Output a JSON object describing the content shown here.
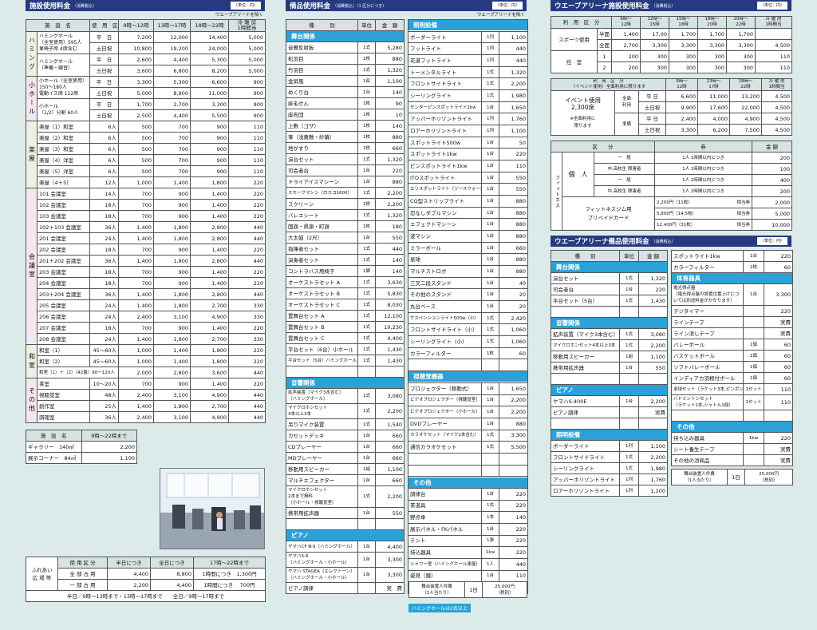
{
  "col1": {
    "title": "施設使用料金",
    "tax": "（消費税込）",
    "unit": "（単位：円）",
    "note": "ウエーブアリーナを除く",
    "h_name": "施　設　名",
    "h_div": "使　用　区　分",
    "h_t": [
      "9時〜12時",
      "13時〜17時",
      "18時〜22時",
      "冷 暖 房\n1時間当"
    ],
    "groups": [
      {
        "name": "ハミング",
        "rows": [
          {
            "n": "ハミングホール\n（全室使用）595人\n車椅子席 4席含む",
            "d": "平　日",
            "v": [
              "7,200",
              "12,000",
              "14,400",
              "5,000"
            ]
          },
          {
            "d": "土日祝",
            "v": [
              "10,800",
              "19,200",
              "24,000",
              "5,000"
            ]
          },
          {
            "n": "ハミングホール\n（準備・練習）",
            "d": "平　日",
            "v": [
              "2,600",
              "4,400",
              "5,300",
              "5,000"
            ]
          },
          {
            "d": "土日祝",
            "v": [
              "3,600",
              "6,800",
              "8,200",
              "5,000"
            ]
          }
        ]
      },
      {
        "name": "小ホール",
        "rows": [
          {
            "n": "小ホール（全室使用）\n150〜180人\n電動イス席 112席",
            "d": "平　日",
            "v": [
              "3,300",
              "5,300",
              "6,600",
              "900"
            ]
          },
          {
            "d": "土日祝",
            "v": [
              "5,000",
              "8,800",
              "11,000",
              "900"
            ]
          },
          {
            "n": "小ホール\n（1/2）分割 60人",
            "d": "平　日",
            "v": [
              "1,700",
              "2,700",
              "3,300",
              "900"
            ]
          },
          {
            "d": "土日祝",
            "v": [
              "2,500",
              "4,400",
              "5,500",
              "900"
            ]
          }
        ]
      },
      {
        "name": "楽屋",
        "rows": [
          {
            "n": "楽屋（1）和室",
            "d": "6人",
            "v": [
              "500",
              "700",
              "900",
              "110"
            ]
          },
          {
            "n": "楽屋（2）和室",
            "d": "6人",
            "v": [
              "500",
              "700",
              "900",
              "110"
            ]
          },
          {
            "n": "楽屋（3）和室",
            "d": "6人",
            "v": [
              "500",
              "700",
              "900",
              "110"
            ]
          },
          {
            "n": "楽屋（4）洋室",
            "d": "6人",
            "v": [
              "500",
              "700",
              "900",
              "110"
            ]
          },
          {
            "n": "楽屋（5）洋室",
            "d": "6人",
            "v": [
              "500",
              "700",
              "900",
              "110"
            ]
          },
          {
            "n": "楽屋（4＋5）",
            "d": "12人",
            "v": [
              "1,000",
              "1,400",
              "1,800",
              "220"
            ]
          }
        ]
      },
      {
        "name": "会議室",
        "rows": [
          {
            "n": "101 会議室",
            "d": "14人",
            "v": [
              "700",
              "900",
              "1,400",
              "220"
            ]
          },
          {
            "n": "102 会議室",
            "d": "18人",
            "v": [
              "700",
              "900",
              "1,400",
              "220"
            ]
          },
          {
            "n": "103 会議室",
            "d": "18人",
            "v": [
              "700",
              "900",
              "1,400",
              "220"
            ]
          },
          {
            "n": "102＋103 会議室",
            "d": "36人",
            "v": [
              "1,400",
              "1,800",
              "2,800",
              "440"
            ]
          },
          {
            "n": "201 会議室",
            "d": "24人",
            "v": [
              "1,400",
              "1,800",
              "2,800",
              "440"
            ]
          },
          {
            "n": "202 会議室",
            "d": "18人",
            "v": [
              "700",
              "900",
              "1,400",
              "220"
            ]
          },
          {
            "n": "201＋202 会議室",
            "d": "36人",
            "v": [
              "1,400",
              "1,800",
              "2,800",
              "440"
            ]
          },
          {
            "n": "203 会議室",
            "d": "18人",
            "v": [
              "700",
              "900",
              "1,400",
              "220"
            ]
          },
          {
            "n": "204 会議室",
            "d": "18人",
            "v": [
              "700",
              "900",
              "1,400",
              "220"
            ]
          },
          {
            "n": "203＋204 会議室",
            "d": "36人",
            "v": [
              "1,400",
              "1,800",
              "2,800",
              "440"
            ]
          },
          {
            "n": "205 会議室",
            "d": "24人",
            "v": [
              "1,400",
              "1,800",
              "2,700",
              "330"
            ]
          },
          {
            "n": "206 会議室",
            "d": "24人",
            "v": [
              "2,400",
              "3,100",
              "4,900",
              "330"
            ]
          },
          {
            "n": "207 会議室",
            "d": "18人",
            "v": [
              "700",
              "900",
              "1,400",
              "220"
            ]
          },
          {
            "n": "208 会議室",
            "d": "24人",
            "v": [
              "1,400",
              "1,800",
              "2,700",
              "330"
            ]
          }
        ]
      },
      {
        "name": "和室",
        "rows": [
          {
            "n": "和室（1）",
            "d": "45〜60人",
            "v": [
              "1,000",
              "1,400",
              "1,800",
              "220"
            ]
          },
          {
            "n": "和室（2）",
            "d": "45〜60人",
            "v": [
              "1,000",
              "1,400",
              "1,800",
              "220"
            ]
          },
          {
            "n": "和室（1）＋（2）（42畳）90〜120人",
            "d": "",
            "v": [
              "2,000",
              "2,800",
              "3,600",
              "440"
            ]
          }
        ]
      },
      {
        "name": "その他",
        "rows": [
          {
            "n": "茶室",
            "d": "10〜20人",
            "v": [
              "700",
              "900",
              "1,400",
              "220"
            ]
          },
          {
            "n": "視聴覚室",
            "d": "48人",
            "v": [
              "2,400",
              "3,100",
              "4,900",
              "440"
            ]
          },
          {
            "n": "創作室",
            "d": "25人",
            "v": [
              "1,400",
              "1,800",
              "2,700",
              "440"
            ]
          },
          {
            "n": "調理室",
            "d": "36人",
            "v": [
              "2,400",
              "3,100",
              "4,900",
              "440"
            ]
          }
        ]
      }
    ],
    "gal_h": [
      "施　設　名",
      "9時〜22時まで"
    ],
    "gal": [
      [
        "ギャラリー　140㎡",
        "2,200"
      ],
      [
        "展示コーナー　84㎡",
        "1,100"
      ]
    ],
    "fure_name": "ふれあい\n広 場 等",
    "fure_h": [
      "使 用 区 分",
      "半日につき",
      "全日につき",
      "17時〜22時まで"
    ],
    "fure": [
      [
        "全 部 占 用",
        "4,400",
        "8,800",
        "1時間につき　1,300円"
      ],
      [
        "一 部 占 用",
        "2,200",
        "4,400",
        "1時間につき　 700円"
      ]
    ],
    "fure_note": "半日／9時〜13時まで・13時〜17時まで　　全日／9時〜17時まで"
  },
  "col2": {
    "title": "備品使用料金",
    "tax": "（消費税込）（1 区分につき）",
    "unit": "（単位：円）",
    "note": "ウエーブアリーナを除く",
    "h": [
      "種　　　別",
      "単位",
      "金　額"
    ],
    "left": [
      {
        "cat": "舞台関係"
      },
      [
        "音響反射板",
        "1式",
        "5,280"
      ],
      [
        "松羽目",
        "1枚",
        "880"
      ],
      [
        "竹羽目",
        "1式",
        "1,320"
      ],
      [
        "金屏風",
        "1双",
        "1,100"
      ],
      [
        "めくり台",
        "1台",
        "140"
      ],
      [
        "緋毛せん",
        "1枚",
        "90"
      ],
      [
        "座布団",
        "1枚",
        "10"
      ],
      [
        "上敷（ゴザ）",
        "1枚",
        "140"
      ],
      [
        "箏（浅黄敷・紗幕）",
        "1枚",
        "880"
      ],
      [
        "地がすり",
        "1枚",
        "660"
      ],
      [
        "演台セット",
        "1式",
        "1,320"
      ],
      [
        "司会者台",
        "1台",
        "220"
      ],
      [
        "ドライアイスマシーン",
        "1台",
        "880"
      ],
      [
        "スモークマシン（ロスコ1600）",
        "1式",
        "2,200"
      ],
      [
        "スクリーン",
        "1枚",
        "2,200"
      ],
      [
        "バレエシート",
        "1式",
        "1,320"
      ],
      [
        "国旗・県旗・町旗",
        "1枚",
        "180"
      ],
      [
        "大太鼓（2尺）",
        "1台",
        "550"
      ],
      [
        "指揮者セット",
        "1式",
        "440"
      ],
      [
        "演奏者セット",
        "1式",
        "140"
      ],
      [
        "コントラバス用椅子",
        "1脚",
        "140"
      ],
      [
        "オーケストラセット A",
        "1式",
        "3,630"
      ],
      [
        "オーケストラセット B",
        "1式",
        "5,830"
      ],
      [
        "オーケストラセット C",
        "1式",
        "8,030"
      ],
      [
        "置舞台セット A",
        "1式",
        "12,100"
      ],
      [
        "置舞台セット B",
        "1式",
        "10,230"
      ],
      [
        "置舞台セット C",
        "1式",
        "4,400"
      ],
      [
        "平台セット（6台）小ホール",
        "1式",
        "1,430"
      ],
      [
        "平台セット（5台）ハミングホール",
        "1式",
        "1,430"
      ],
      [
        "",
        "",
        " "
      ],
      {
        "cat": "音響関係"
      },
      [
        "拡声装置（マイク3本含む）\n（ハミングホール）",
        "1式",
        "3,080"
      ],
      [
        "マイクロホンセット\n4本以上3本",
        "1式",
        "2,200"
      ],
      [
        "吊りマイク装置",
        "1式",
        "1,540"
      ],
      [
        "カセットデッキ",
        "1台",
        "660"
      ],
      [
        "CDプレーヤー",
        "1台",
        "660"
      ],
      [
        "MDプレーヤー",
        "1台",
        "660"
      ],
      [
        "移動用スピーカー",
        "1組",
        "1,100"
      ],
      [
        "マルチエフェクター",
        "1台",
        "660"
      ],
      [
        "マイクロホンセット\n2本まで無料\n（小ホール・視聴覚室）",
        "1式",
        "2,200"
      ],
      [
        "携帯用拡声器",
        "1台",
        "550"
      ],
      [
        "",
        "",
        " "
      ],
      {
        "cat": "ピアノ"
      },
      [
        "ヤマハCF Ⅲ-S（ハミングホール）",
        "1台",
        "4,400"
      ],
      [
        "ヤマハS-6\n（ハミングホール・小ホール）",
        "1台",
        "3,300"
      ],
      [
        "ヤマハ STAGEA（エレクトーン）\n（ハミングホール・小ホール）",
        "1台",
        "3,300"
      ],
      [
        "ピアノ調律",
        "",
        "実　費"
      ]
    ],
    "right": [
      {
        "cat": "照明設備"
      },
      [
        "ボーダーライト",
        "1列",
        "1,100"
      ],
      [
        "フットライト",
        "1列",
        "440"
      ],
      [
        "花道フットライト",
        "1列",
        "440"
      ],
      [
        "トーメンタルライト",
        "1式",
        "1,320"
      ],
      [
        "フロントサイドライト",
        "1式",
        "2,200"
      ],
      [
        "シーリングライト",
        "1式",
        "1,980"
      ],
      [
        "センターピンスポットライト2kw",
        "1台",
        "1,650"
      ],
      [
        "アッパーホリゾントライト",
        "1列",
        "1,760"
      ],
      [
        "ロアーホリゾントライト",
        "1列",
        "1,100"
      ],
      [
        "スポットライト500w",
        "1台",
        "50"
      ],
      [
        "スポットライト1kw",
        "1台",
        "220"
      ],
      [
        "ピンスポットライト1kw",
        "1台",
        "110"
      ],
      [
        "ITOスポットライト",
        "1台",
        "550"
      ],
      [
        "エリスポットライト（ソースフォー含む）",
        "1台",
        "550"
      ],
      [
        "CQ型ストリップライト",
        "1台",
        "880"
      ],
      [
        "忍なしダブルマシン",
        "1台",
        "880"
      ],
      [
        "エフェクトマシーン",
        "1台",
        "880"
      ],
      [
        "波マシン",
        "1台",
        "880"
      ],
      [
        "ミラーボール",
        "1台",
        "660"
      ],
      [
        "星球",
        "1台",
        "880"
      ],
      [
        "マルチストロボ",
        "1台",
        "880"
      ],
      [
        "三叉二段スタンド",
        "1台",
        "40"
      ],
      [
        "その他のスタンド",
        "1台",
        "20"
      ],
      [
        "丸台ベース",
        "1台",
        "20"
      ],
      [
        "サスペンションライト500w（小）",
        "1式",
        "2,420"
      ],
      [
        "フロントサイドライト（小）",
        "1式",
        "1,060"
      ],
      [
        "シーリングライト（小）",
        "1式",
        "1,060"
      ],
      [
        "カラーフィルター",
        "1枚",
        "60"
      ],
      [
        "",
        "",
        " "
      ],
      {
        "cat": "視聴覚機器"
      },
      [
        "プロジェクター（移動式）",
        "1台",
        "1,650"
      ],
      [
        "ビデオプロジェクター（視聴覚室）",
        "1台",
        "2,200"
      ],
      [
        "ビデオプロジェクター（小ホール）",
        "1台",
        "2,200"
      ],
      [
        "DVDプレーヤー",
        "1台",
        "880"
      ],
      [
        "カラオケセット（マイク2本含む）",
        "1式",
        "3,300"
      ],
      [
        "通信カラオケセット",
        "1式",
        "5,500"
      ],
      [
        "",
        "",
        " "
      ],
      [
        "",
        "",
        " "
      ],
      {
        "cat": "その他"
      },
      [
        "調律台",
        "1台",
        "220"
      ],
      [
        "茶道具",
        "1式",
        "220"
      ],
      [
        "野点傘",
        "1本",
        "140"
      ],
      [
        "展示パネル・FKパネル",
        "1台",
        "220"
      ],
      [
        "テント",
        "1張",
        "220"
      ],
      [
        "持込器具",
        "1kw",
        "220"
      ],
      [
        "シャワー室（ハミングホール楽屋）",
        "1人",
        "440"
      ],
      [
        "姿見（鏡）",
        "1台",
        "110"
      ],
      [
        "電動イス（小ホール）",
        "1式",
        "500"
      ]
    ],
    "staff_l": "舞台装置人件費\n（1人当たり）",
    "staff_u": "1日",
    "staff_v": "25,000円\n（税別）",
    "staff_note": "ハミングホールは2名以上"
  },
  "col3": {
    "t1": "ウエーブアリーナ施設使用料金",
    "t1_tax": "（消費税込）",
    "unit": "（単位：円）",
    "h1": [
      "利　用　区　分",
      "9時〜\n12時",
      "12時〜\n15時",
      "15時〜\n18時",
      "18時〜\n20時",
      "20時〜\n22時",
      "冷 暖 房\n1時間当"
    ],
    "sport": "スポーツ使用",
    "ctrl": "控　室",
    "r1": [
      [
        "半面",
        "1,400",
        "17,00",
        "1,700",
        "1,700",
        "1,700",
        ""
      ],
      [
        "全面",
        "2,700",
        "3,300",
        "3,300",
        "3,300",
        "3,300",
        "4,500"
      ],
      [
        "1",
        "200",
        "300",
        "300",
        "300",
        "300",
        "110"
      ],
      [
        "2",
        "200",
        "300",
        "300",
        "300",
        "300",
        "110"
      ]
    ],
    "h2a": "利　用　区　分",
    "h2b": "（イベント使用）全面利用に限ります",
    "h2": [
      "9時〜\n12時",
      "13時〜\n17時",
      "18時〜\n22時",
      "冷 暖 房\n1時間当"
    ],
    "event": "イベント使用\n2,300席",
    "event_note": "※全面利用に\n限ります",
    "full": "全面\n利用",
    "prep": "準備",
    "r2": [
      [
        "平 日",
        "6,600",
        "11,000",
        "13,200",
        "4,500"
      ],
      [
        "土日祝",
        "9,900",
        "17,600",
        "22,000",
        "4,500"
      ],
      [
        "平 日",
        "2,400",
        "4,000",
        "4,900",
        "4,500"
      ],
      [
        "土日祝",
        "3,300",
        "6,200",
        "7,500",
        "4,500"
      ]
    ],
    "h3": [
      "区　　分",
      "券",
      "金 額"
    ],
    "fit": "フィットネス",
    "indiv": "個　人",
    "r3": [
      [
        "一　般",
        "1人 1時間以内につき",
        "200"
      ],
      [
        "中.高校生 障害者",
        "1人 1時間以内につき",
        "100"
      ],
      [
        "一　般",
        "1人 2時間以内につき",
        "400"
      ],
      [
        "中.高校生 障害者",
        "1人 2時間以内につき",
        "200"
      ]
    ],
    "card": "フィットネスジム用\nプリペイドカード",
    "cards": [
      [
        "2,200円（11枚）",
        "相当券",
        "2,000"
      ],
      [
        "5,800円（14.5枚）",
        "相当券",
        "5,000"
      ],
      [
        "12,400円（31枚）",
        "相当券",
        "10,000"
      ]
    ],
    "t2": "ウエーブアリーナ備品使用料金",
    "t2_tax": "（消費税込）",
    "h4": [
      "種　　別",
      "単位",
      "金 額"
    ],
    "bl": [
      {
        "cat": "舞台関係"
      },
      [
        "演台セット",
        "1式",
        "1,320"
      ],
      [
        "司会者台",
        "1台",
        "220"
      ],
      [
        "平台セット（5台）",
        "1式",
        "1,430"
      ],
      [
        "",
        "",
        " "
      ],
      {
        "cat": "音響関係"
      },
      [
        "拡声装置（マイク3本含む）",
        "1式",
        "3,080"
      ],
      [
        "マイクロホンセット4本以上3本",
        "1式",
        "2,200"
      ],
      [
        "移動用スピーカー",
        "1組",
        "1,100"
      ],
      [
        "携帯用拡声器",
        "1台",
        "550"
      ],
      [
        "",
        "",
        " "
      ],
      {
        "cat": "ピアノ"
      },
      [
        "ヤマハS-400E",
        "1台",
        "2,200"
      ],
      [
        "ピアノ調律",
        "",
        "実費"
      ],
      [
        "",
        "",
        " "
      ],
      {
        "cat": "照明設備"
      },
      [
        "ボーダーライト",
        "1列",
        "1,100"
      ],
      [
        "フロントサイドライト",
        "1式",
        "2,200"
      ],
      [
        "シーリングライト",
        "1式",
        "1,980"
      ],
      [
        "アッパーホリゾントライト",
        "1列",
        "1,760"
      ],
      [
        "ロアーホリゾントライト",
        "1列",
        "1,100"
      ]
    ],
    "br": [
      [
        "スポットライト1kw",
        "1台",
        "220"
      ],
      [
        "カラーフィルター",
        "1枚",
        "60"
      ],
      {
        "cat": "体育器具"
      },
      [
        "電光得点盤\n（電光得点盤の設置位置上げについては別途料金がかかります）",
        "1台",
        "3,300"
      ],
      [
        "デジタイマー",
        "",
        "220"
      ],
      [
        "ラインテープ",
        "",
        "実費"
      ],
      [
        "ライン消しテープ",
        "",
        "実費"
      ],
      [
        "バレーボール",
        "1個",
        "60"
      ],
      [
        "バスケットボール",
        "1個",
        "60"
      ],
      [
        "ソフトバレーボール",
        "1個",
        "60"
      ],
      [
        "インディアカ羽根付ボール",
        "1個",
        "60"
      ],
      [
        "卓球セット（ラケット3本,ピンポン玉1個）",
        "1セット",
        "110"
      ],
      [
        "バドミントンセット\n（ラケット1本,シャトル1個）",
        "1セット",
        "110"
      ],
      [
        "",
        "",
        " "
      ],
      {
        "cat": "その他"
      },
      [
        "持ち込み器具",
        "1kw",
        "220"
      ],
      [
        "シート養生テープ",
        "",
        "実費"
      ],
      [
        "その他の消耗品",
        "",
        "実費"
      ]
    ],
    "staff_l": "舞台装置人件費\n（1人当たり）",
    "staff_u": "1日",
    "staff_v": "25,000円\n（税別）"
  }
}
